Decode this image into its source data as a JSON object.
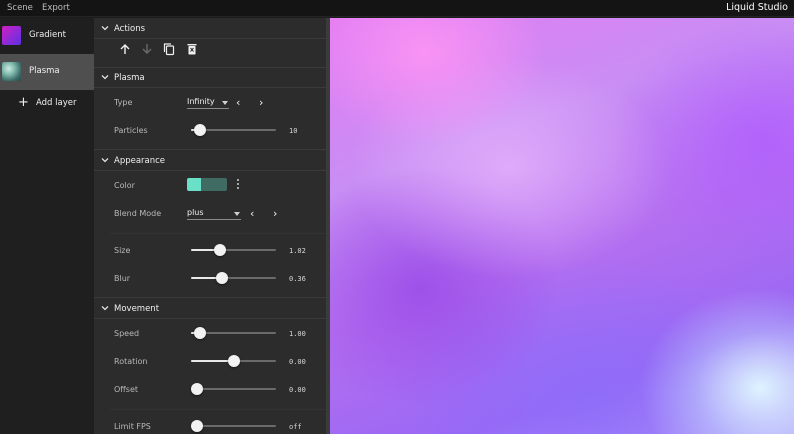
{
  "menu": {
    "scene": "Scene",
    "export": "Export"
  },
  "app_title": "Liquid Studio",
  "layers": [
    {
      "name": "Gradient",
      "icon": "gradient-thumbnail",
      "active": false
    },
    {
      "name": "Plasma",
      "icon": "plasma-thumbnail",
      "active": true
    }
  ],
  "add_layer_label": "Add layer",
  "sections": {
    "actions": {
      "title": "Actions",
      "icons": [
        "arrow-up-icon",
        "arrow-down-icon",
        "copy-icon",
        "delete-icon"
      ]
    },
    "plasma": {
      "title": "Plasma",
      "type": {
        "label": "Type",
        "value": "Infinity"
      },
      "particles": {
        "label": "Particles",
        "value": "10",
        "level": 0.1
      }
    },
    "appearance": {
      "title": "Appearance",
      "color": {
        "label": "Color",
        "swatch_a": "#6be0c8",
        "swatch_b": "#3f6b63"
      },
      "blend_mode": {
        "label": "Blend Mode",
        "value": "plus"
      },
      "size": {
        "label": "Size",
        "value": "1.02",
        "level": 0.34
      },
      "blur": {
        "label": "Blur",
        "value": "0.36",
        "level": 0.36
      }
    },
    "movement": {
      "title": "Movement",
      "speed": {
        "label": "Speed",
        "value": "1.00",
        "level": 0.1
      },
      "rotation": {
        "label": "Rotation",
        "value": "0.00",
        "level": 0.5
      },
      "offset": {
        "label": "Offset",
        "value": "0.00",
        "level": 0.0
      },
      "limit_fps": {
        "label": "Limit FPS",
        "value": "off",
        "level": 0.0
      }
    }
  },
  "colors": {
    "accent_swatch": "#6be0c8",
    "panel_bg": "#2c2c2c",
    "active_layer": "#4f4f4f"
  }
}
